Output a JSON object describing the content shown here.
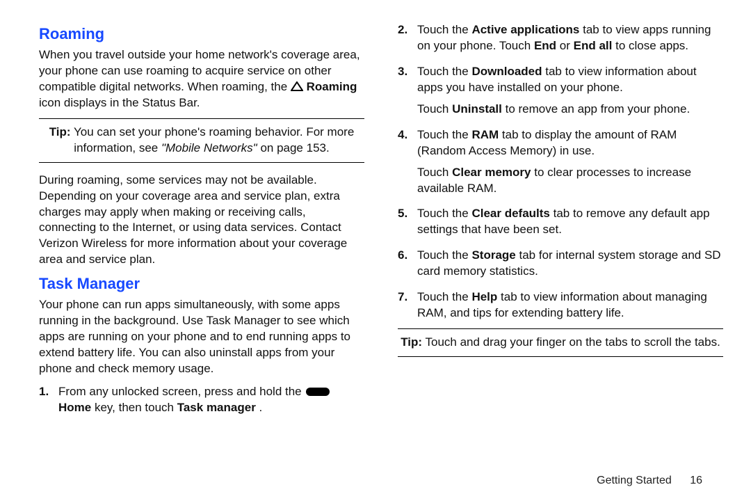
{
  "roaming": {
    "heading": "Roaming",
    "para1a": "When you travel outside your home network's coverage area, your phone can use roaming to acquire service on other compatible digital networks. When roaming, the ",
    "para1b_strong": "Roaming",
    "para1c": " icon displays in the Status Bar.",
    "tip_label": "Tip:",
    "tip_a": " You can set your phone's roaming behavior. For more information, see ",
    "tip_ref": "\"Mobile Networks\"",
    "tip_b": " on page 153.",
    "para2": "During roaming, some services may not be available. Depending on your coverage area and service plan, extra charges may apply when making or receiving calls, connecting to the Internet, or using data services. Contact Verizon Wireless for more information about your coverage area and service plan."
  },
  "taskmgr": {
    "heading": "Task Manager",
    "intro": "Your phone can run apps simultaneously, with some apps running in the background. Use Task Manager to see which apps are running on your phone and to end running apps to extend battery life. You can also uninstall apps from your phone and check memory usage."
  },
  "steps": {
    "s1a": "From any unlocked screen, press and hold the ",
    "s1_home": " Home",
    "s1b": " key, then touch ",
    "s1_tm": "Task manager",
    "s1c": ".",
    "s2a": "Touch the ",
    "s2_bold": "Active applications",
    "s2b": " tab to view apps running on your phone. Touch ",
    "s2_end": "End",
    "s2c": " or ",
    "s2_endall": "End all",
    "s2d": " to close apps.",
    "s3a": "Touch the ",
    "s3_bold": "Downloaded",
    "s3b": " tab to view information about apps you have installed on your phone.",
    "s3_sub_a": "Touch ",
    "s3_sub_bold": "Uninstall",
    "s3_sub_b": " to remove an app from your phone.",
    "s4a": "Touch the ",
    "s4_bold": "RAM",
    "s4b": " tab to display the amount of RAM (Random Access Memory) in use.",
    "s4_sub_a": "Touch ",
    "s4_sub_bold": "Clear memory",
    "s4_sub_b": " to clear processes to increase available RAM.",
    "s5a": "Touch the ",
    "s5_bold": "Clear defaults",
    "s5b": " tab to remove any default app settings that have been set.",
    "s6a": "Touch the ",
    "s6_bold": "Storage",
    "s6b": " tab for internal system storage and SD card memory statistics.",
    "s7a": "Touch the ",
    "s7_bold": "Help",
    "s7b": " tab to view information about managing RAM, and tips for extending battery life."
  },
  "tip2": {
    "label": "Tip:",
    "text": " Touch and drag your finger on the tabs to scroll the tabs."
  },
  "footer": {
    "section": "Getting Started",
    "page": "16"
  }
}
